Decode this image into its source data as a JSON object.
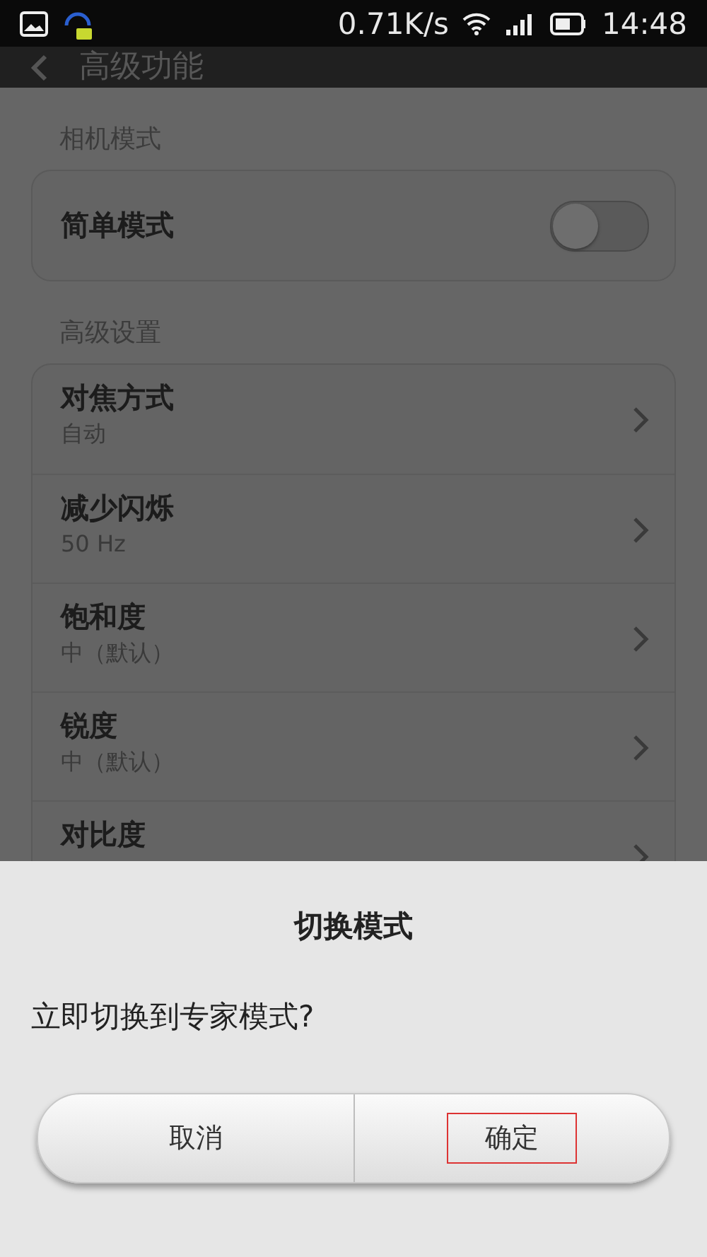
{
  "status_bar": {
    "speed": "0.71K/s",
    "time": "14:48"
  },
  "header": {
    "title": "高级功能"
  },
  "sections": [
    {
      "label": "相机模式",
      "items": [
        {
          "kind": "switch",
          "title": "简单模式",
          "on": false
        }
      ]
    },
    {
      "label": "高级设置",
      "items": [
        {
          "kind": "link",
          "title": "对焦方式",
          "value": "自动"
        },
        {
          "kind": "link",
          "title": "减少闪烁",
          "value": "50 Hz"
        },
        {
          "kind": "link",
          "title": "饱和度",
          "value": "中（默认）"
        },
        {
          "kind": "link",
          "title": "锐度",
          "value": "中（默认）"
        },
        {
          "kind": "link",
          "title": "对比度"
        }
      ]
    }
  ],
  "dialog": {
    "title": "切换模式",
    "message": "立即切换到专家模式?",
    "buttons": [
      {
        "label": "取消",
        "highlighted": false
      },
      {
        "label": "确定",
        "highlighted": true
      }
    ]
  }
}
